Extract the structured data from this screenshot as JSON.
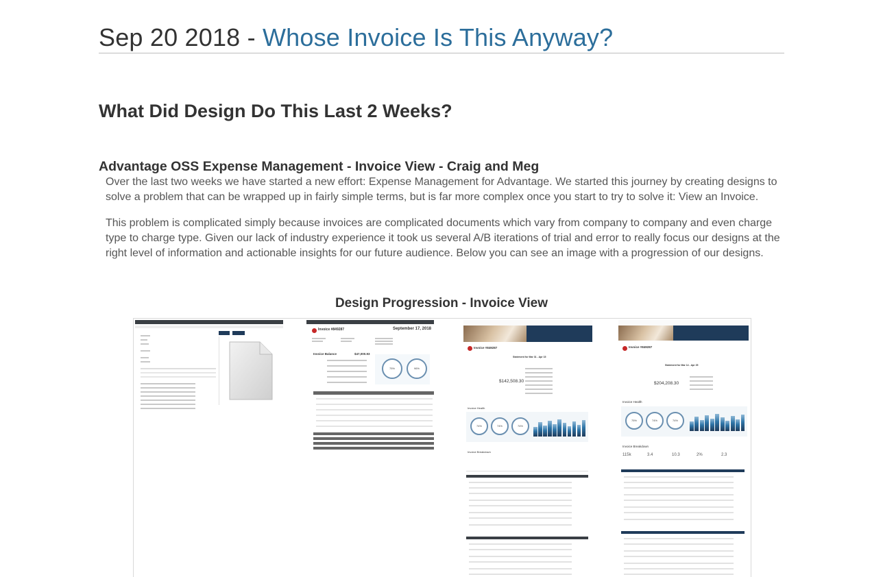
{
  "header": {
    "date": "Sep 20 2018",
    "separator": " - ",
    "link_text": "Whose Invoice Is This Anyway?"
  },
  "section": {
    "heading": "What Did Design Do This Last 2 Weeks?",
    "subheading": "Advantage OSS Expense Management - Invoice View - Craig and Meg",
    "paragraphs": [
      "Over the last two weeks we have started a new effort: Expense Management for Advantage. We started this journey by creating designs to solve a problem that can be wrapped up in fairly simple terms, but is far more complex once you start to try to solve it: View an Invoice.",
      "This problem is complicated simply because invoices are complicated documents which vary from company to company and even charge type to charge type. Given our lack of industry experience it took us several A/B iterations of trial and error to really focus our designs at the right level of information and actionable insights for our future audience. Below you can see an image with a progression of our designs."
    ]
  },
  "figure": {
    "caption": "Design Progression - Invoice View",
    "v2": {
      "invoice_title": "Invoice #849287",
      "date": "September 17, 2018",
      "invoice_balance_label": "Invoice Balance",
      "invoice_balance_value": "$47,000.93",
      "ring_labels": [
        "75%",
        "96%"
      ]
    },
    "v3": {
      "invoice_title": "Invoice #849287",
      "statement_label": "Statement for Mar 31 - Apr 15",
      "amount": "$142,508.30",
      "health_label": "Invoice Health",
      "breakdown_label": "Invoice Breakdown",
      "ring_labels": [
        "74%",
        "74%",
        "74%"
      ]
    },
    "v4": {
      "invoice_title": "Invoice #849287",
      "statement_label": "Statement for Mar 14 - Apr 25",
      "amount": "$204,208.30",
      "health_label": "Invoice Health",
      "breakdown_label": "Invoice Breakdown",
      "ring_labels": [
        "75%",
        "74%",
        "74%"
      ],
      "metric_values": [
        "115k",
        "3.4",
        "10.3",
        "2%",
        "2.3"
      ]
    },
    "colors": {
      "navy": "#1f3b5a",
      "accent_red": "#c62828",
      "chart_blue": "#2e75a8",
      "chart_light": "#8fb8d6"
    }
  }
}
